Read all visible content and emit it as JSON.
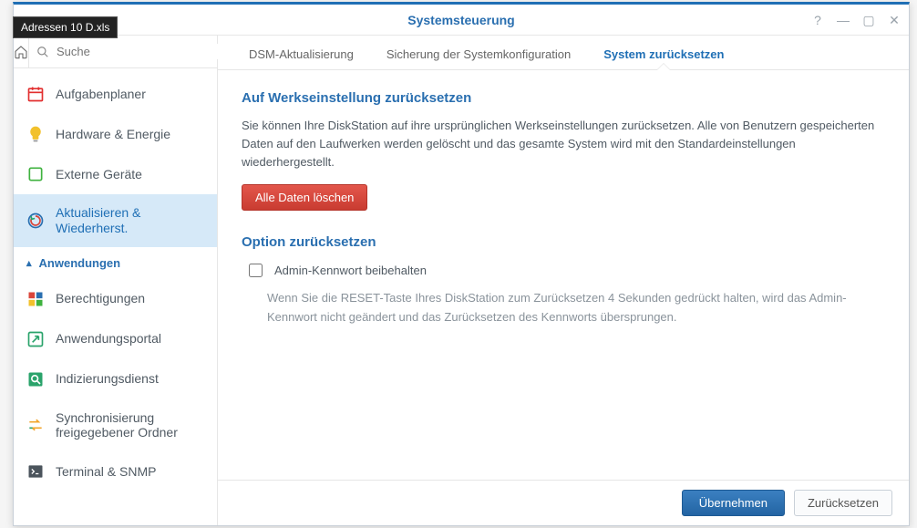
{
  "tooltip": "Adressen 10 D.xls",
  "window": {
    "title": "Systemsteuerung",
    "controls": {
      "help": "?",
      "min": "—",
      "max": "▢",
      "close": "✕"
    }
  },
  "sidebar": {
    "search_placeholder": "Suche",
    "items": [
      {
        "label": "Aufgabenplaner",
        "icon": "calendar",
        "color": "#e22f2f"
      },
      {
        "label": "Hardware & Energie",
        "icon": "bulb",
        "color": "#f2c12c"
      },
      {
        "label": "Externe Geräte",
        "icon": "eject",
        "color": "#3fb23f"
      },
      {
        "label": "Aktualisieren & Wiederherst.",
        "icon": "restore",
        "color": "#2a6fb0",
        "active": true
      }
    ],
    "group_label": "Anwendungen",
    "items2": [
      {
        "label": "Berechtigungen",
        "icon": "perm"
      },
      {
        "label": "Anwendungsportal",
        "icon": "portal",
        "color": "#2aa36b"
      },
      {
        "label": "Indizierungsdienst",
        "icon": "index",
        "color": "#2aa36b"
      },
      {
        "label": "Synchronisierung freigegebener Ordner",
        "icon": "sync"
      },
      {
        "label": "Terminal & SNMP",
        "icon": "terminal",
        "color": "#555"
      }
    ]
  },
  "tabs": [
    {
      "label": "DSM-Aktualisierung"
    },
    {
      "label": "Sicherung der Systemkonfiguration"
    },
    {
      "label": "System zurücksetzen",
      "active": true
    }
  ],
  "section1": {
    "title": "Auf Werkseinstellung zurücksetzen",
    "desc": "Sie können Ihre DiskStation auf ihre ursprünglichen Werkseinstellungen zurücksetzen. Alle von Benutzern gespeicherten Daten auf den Laufwerken werden gelöscht und das gesamte System wird mit den Standardeinstellungen wiederhergestellt.",
    "button": "Alle Daten löschen"
  },
  "section2": {
    "title": "Option zurücksetzen",
    "checkbox_label": "Admin-Kennwort beibehalten",
    "hint": "Wenn Sie die RESET-Taste Ihres DiskStation zum Zurücksetzen 4 Sekunden gedrückt halten, wird das Admin-Kennwort nicht geändert und das Zurücksetzen des Kennworts übersprungen."
  },
  "footer": {
    "apply": "Übernehmen",
    "reset": "Zurücksetzen"
  }
}
